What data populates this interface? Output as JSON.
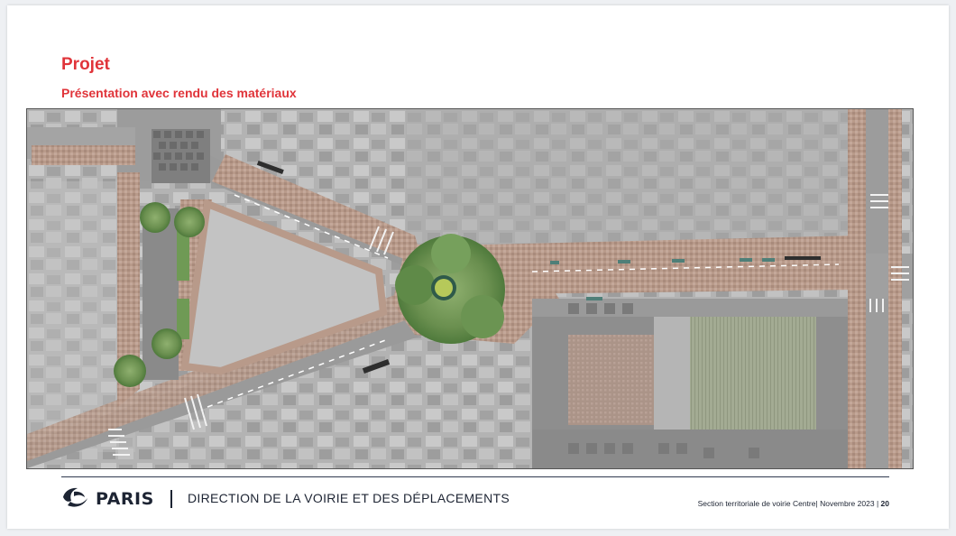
{
  "slide": {
    "title": "Projet",
    "subtitle": "Présentation avec rendu des matériaux"
  },
  "footer": {
    "logo_text": "PARIS",
    "logo_icon": "paris-boat-icon",
    "separator": "|",
    "direction": "DIRECTION DE LA VOIRIE ET DES DÉPLACEMENTS",
    "section": "Section territoriale de voirie Centre",
    "date": "Novembre 2023",
    "page_number": "20"
  },
  "colors": {
    "accent": "#e0343a",
    "navy": "#1d2433",
    "paving": "#b89a8a",
    "greenery": "#6f9a55",
    "roof": "#9fa68f",
    "asphalt": "#9a9a9a"
  }
}
